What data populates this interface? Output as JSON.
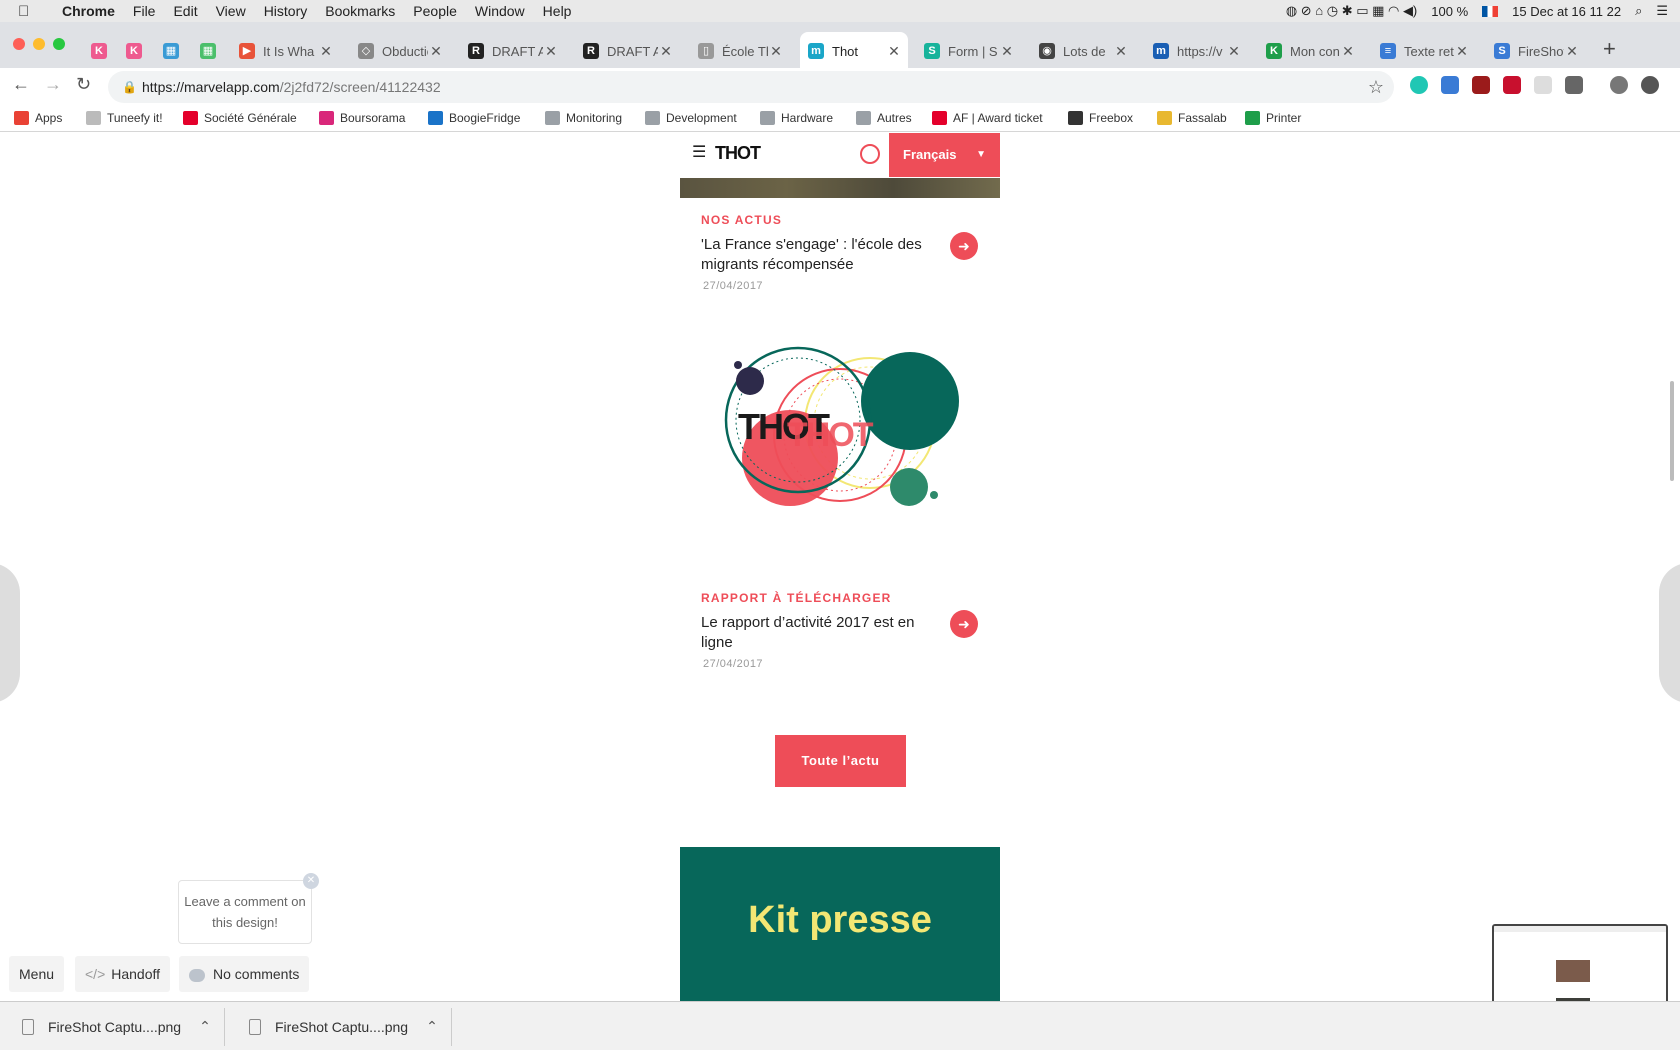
{
  "menubar": {
    "apple": "",
    "items": [
      "Chrome",
      "File",
      "Edit",
      "View",
      "History",
      "Bookmarks",
      "People",
      "Window",
      "Help"
    ],
    "battery": "100 %",
    "datetime": "15 Dec at 16 11 22"
  },
  "tabs": [
    {
      "label": "",
      "fav_color": "#ee5a8f",
      "fav_glyph": "K"
    },
    {
      "label": "",
      "fav_color": "#ee5a8f",
      "fav_glyph": "K"
    },
    {
      "label": "",
      "fav_color": "#3a9bd5",
      "fav_glyph": "▦"
    },
    {
      "label": "",
      "fav_color": "#4bbf6b",
      "fav_glyph": "▦"
    },
    {
      "label": "It Is Wha",
      "fav_color": "#e8533a",
      "fav_glyph": "▶"
    },
    {
      "label": "Obductio",
      "fav_color": "#888888",
      "fav_glyph": "◇"
    },
    {
      "label": "DRAFT A",
      "fav_color": "#222222",
      "fav_glyph": "R"
    },
    {
      "label": "DRAFT A",
      "fav_color": "#222222",
      "fav_glyph": "R"
    },
    {
      "label": "École Th",
      "fav_color": "#999999",
      "fav_glyph": "▯"
    },
    {
      "label": "Thot",
      "fav_color": "#1aa6c8",
      "fav_glyph": "m",
      "active": true
    },
    {
      "label": "Form | S",
      "fav_color": "#17b39b",
      "fav_glyph": "S"
    },
    {
      "label": "Lots de",
      "fav_color": "#444444",
      "fav_glyph": "◉"
    },
    {
      "label": "https://v",
      "fav_color": "#1a5fb4",
      "fav_glyph": "m"
    },
    {
      "label": "Mon con",
      "fav_color": "#1e9e4a",
      "fav_glyph": "K"
    },
    {
      "label": "Texte ret",
      "fav_color": "#3a7bd5",
      "fav_glyph": "≡"
    },
    {
      "label": "FireShot",
      "fav_color": "#3a7bd5",
      "fav_glyph": "S"
    }
  ],
  "address": {
    "host": "https://marvelapp.com",
    "path": "/2j2fd72/screen/41122432"
  },
  "bookmarks": [
    {
      "label": "Apps",
      "color": "#e94235"
    },
    {
      "label": "Tuneefy it!",
      "color": "#bbbbbb"
    },
    {
      "label": "Société Générale",
      "color": "#e4002b"
    },
    {
      "label": "Boursorama",
      "color": "#d9277a"
    },
    {
      "label": "BoogieFridge",
      "color": "#1a73c8"
    },
    {
      "label": "Monitoring",
      "color": "#9aa0a6"
    },
    {
      "label": "Development",
      "color": "#9aa0a6"
    },
    {
      "label": "Hardware",
      "color": "#9aa0a6"
    },
    {
      "label": "Autres",
      "color": "#9aa0a6"
    },
    {
      "label": "AF | Award ticket",
      "color": "#e4002b"
    },
    {
      "label": "Freebox",
      "color": "#333333"
    },
    {
      "label": "Fassalab",
      "color": "#e8b830"
    },
    {
      "label": "Printer",
      "color": "#1e9e4a"
    }
  ],
  "site": {
    "logo": "THOT",
    "language": "Français",
    "news": [
      {
        "category": "NOS ACTUS",
        "title": "'La France s'engage' : l'école des migrants récompensée",
        "date": "27/04/2017"
      },
      {
        "category": "RAPPORT À TÉLÉCHARGER",
        "title": "Le rapport d’activité 2017 est en ligne",
        "date": "27/04/2017"
      }
    ],
    "all_news_button": "Toute l’actu",
    "kit_title": "Kit presse"
  },
  "marvel": {
    "comment_prompt": "Leave a comment on this design!",
    "menu_button": "Menu",
    "handoff_button": "Handoff",
    "comments_button": "No comments"
  },
  "downloads": [
    "FireShot Captu....png",
    "FireShot Captu....png"
  ],
  "colors": {
    "accent": "#ee4d58",
    "kit_bg": "#07675a",
    "kit_text": "#f3e774"
  }
}
